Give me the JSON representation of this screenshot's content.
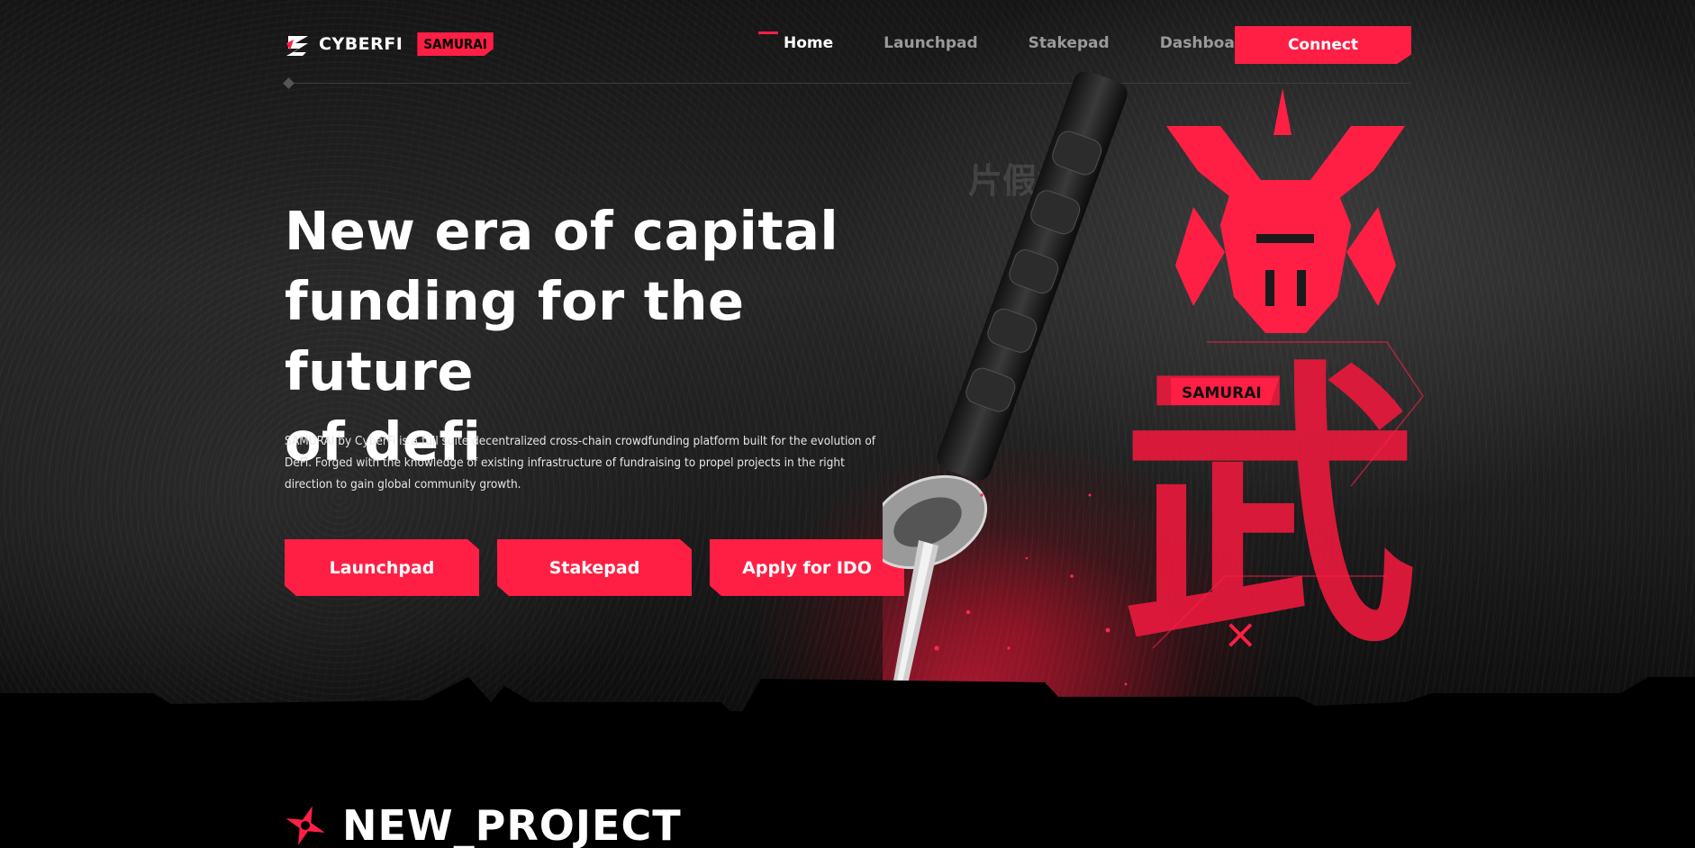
{
  "header": {
    "logo_text": "CYBERFI",
    "logo_badge": "SAMURAI",
    "nav": [
      {
        "label": "Home",
        "active": true
      },
      {
        "label": "Launchpad",
        "active": false
      },
      {
        "label": "Stakepad",
        "active": false
      },
      {
        "label": "Dashboard",
        "active": false
      }
    ],
    "connect_label": "Connect"
  },
  "hero": {
    "title_lines": [
      "New era of capital",
      "funding for the future",
      "of defi"
    ],
    "description_lines": [
      "SAMURAI by CyberFi is a full suite decentralized cross-chain crowdfunding platform built for the evolution of",
      "DeFi. Forged with the knowledge of existing infrastructure of fundraising to propel projects in the right",
      "direction to gain global community growth."
    ],
    "buttons": [
      "Launchpad",
      "Stakepad",
      "Apply for IDO"
    ]
  },
  "artwork": {
    "ghost_text": "片假名",
    "banner_label": "SAMURAI",
    "kanji": "武",
    "icons": [
      "katana-icon",
      "samurai-mask-icon"
    ]
  },
  "section": {
    "title": "NEW_PROJECT",
    "icon": "shuriken-icon"
  },
  "colors": {
    "accent": "#ff1f44",
    "background": "#000000",
    "nav_inactive": "#9a9a9a"
  }
}
